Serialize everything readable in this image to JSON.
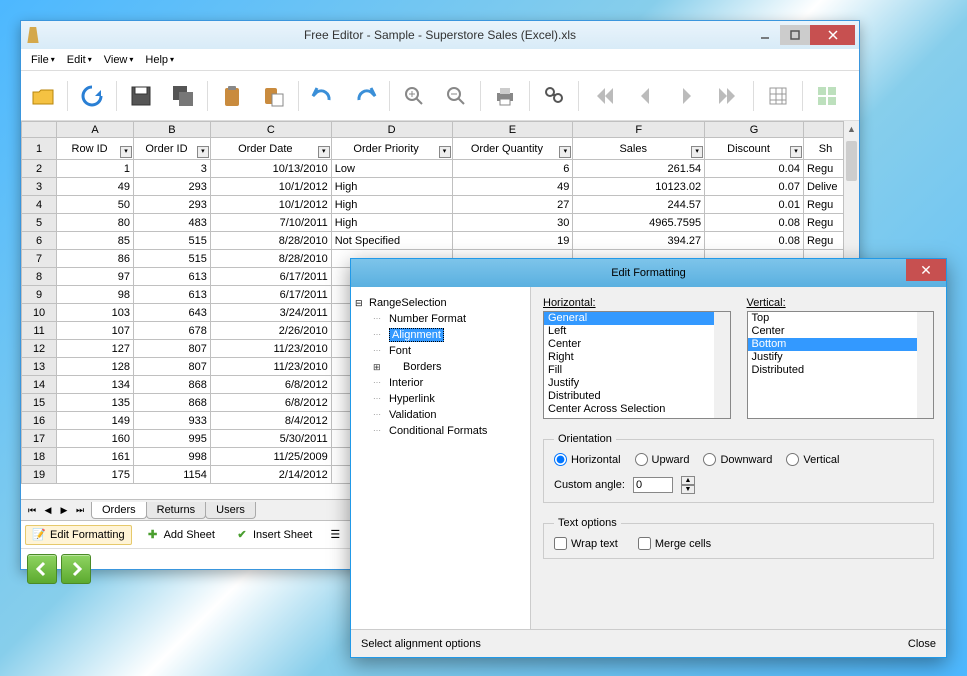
{
  "window": {
    "title": "Free Editor - Sample - Superstore Sales (Excel).xls"
  },
  "menu": {
    "file": "File",
    "edit": "Edit",
    "view": "View",
    "help": "Help"
  },
  "columns_letters": [
    "A",
    "B",
    "C",
    "D",
    "E",
    "F",
    "G",
    ""
  ],
  "field_headers": [
    "Row ID",
    "Order ID",
    "Order Date",
    "Order Priority",
    "Order Quantity",
    "Sales",
    "Discount",
    "Sh"
  ],
  "rows": [
    {
      "n": "2",
      "cells": [
        "1",
        "3",
        "10/13/2010",
        "Low",
        "6",
        "261.54",
        "0.04",
        "Regu"
      ]
    },
    {
      "n": "3",
      "cells": [
        "49",
        "293",
        "10/1/2012",
        "High",
        "49",
        "10123.02",
        "0.07",
        "Delive"
      ]
    },
    {
      "n": "4",
      "cells": [
        "50",
        "293",
        "10/1/2012",
        "High",
        "27",
        "244.57",
        "0.01",
        "Regu"
      ]
    },
    {
      "n": "5",
      "cells": [
        "80",
        "483",
        "7/10/2011",
        "High",
        "30",
        "4965.7595",
        "0.08",
        "Regu"
      ]
    },
    {
      "n": "6",
      "cells": [
        "85",
        "515",
        "8/28/2010",
        "Not Specified",
        "19",
        "394.27",
        "0.08",
        "Regu"
      ]
    },
    {
      "n": "7",
      "cells": [
        "86",
        "515",
        "8/28/2010",
        "",
        "",
        "",
        "",
        ""
      ]
    },
    {
      "n": "8",
      "cells": [
        "97",
        "613",
        "6/17/2011",
        "",
        "",
        "",
        "",
        ""
      ]
    },
    {
      "n": "9",
      "cells": [
        "98",
        "613",
        "6/17/2011",
        "",
        "",
        "",
        "",
        ""
      ]
    },
    {
      "n": "10",
      "cells": [
        "103",
        "643",
        "3/24/2011",
        "",
        "",
        "",
        "",
        ""
      ]
    },
    {
      "n": "11",
      "cells": [
        "107",
        "678",
        "2/26/2010",
        "",
        "",
        "",
        "",
        ""
      ]
    },
    {
      "n": "12",
      "cells": [
        "127",
        "807",
        "11/23/2010",
        "",
        "",
        "",
        "",
        ""
      ]
    },
    {
      "n": "13",
      "cells": [
        "128",
        "807",
        "11/23/2010",
        "",
        "",
        "",
        "",
        ""
      ]
    },
    {
      "n": "14",
      "cells": [
        "134",
        "868",
        "6/8/2012",
        "",
        "",
        "",
        "",
        ""
      ]
    },
    {
      "n": "15",
      "cells": [
        "135",
        "868",
        "6/8/2012",
        "",
        "",
        "",
        "",
        ""
      ]
    },
    {
      "n": "16",
      "cells": [
        "149",
        "933",
        "8/4/2012",
        "",
        "",
        "",
        "",
        ""
      ]
    },
    {
      "n": "17",
      "cells": [
        "160",
        "995",
        "5/30/2011",
        "",
        "",
        "",
        "",
        ""
      ]
    },
    {
      "n": "18",
      "cells": [
        "161",
        "998",
        "11/25/2009",
        "",
        "",
        "",
        "",
        ""
      ]
    },
    {
      "n": "19",
      "cells": [
        "175",
        "1154",
        "2/14/2012",
        "",
        "",
        "",
        "",
        ""
      ]
    }
  ],
  "sheet_tabs": {
    "orders": "Orders",
    "returns": "Returns",
    "users": "Users"
  },
  "bottom_bar": {
    "edit_formatting": "Edit Formatting",
    "add_sheet": "Add Sheet",
    "insert_sheet": "Insert Sheet"
  },
  "dialog": {
    "title": "Edit Formatting",
    "tree": {
      "root": "RangeSelection",
      "number_format": "Number Format",
      "alignment": "Alignment",
      "font": "Font",
      "borders": "Borders",
      "interior": "Interior",
      "hyperlink": "Hyperlink",
      "validation": "Validation",
      "conditional": "Conditional Formats"
    },
    "horizontal_label": "Horizontal:",
    "vertical_label": "Vertical:",
    "horizontal_options": [
      "General",
      "Left",
      "Center",
      "Right",
      "Fill",
      "Justify",
      "Distributed",
      "Center Across Selection"
    ],
    "vertical_options": [
      "Top",
      "Center",
      "Bottom",
      "Justify",
      "Distributed"
    ],
    "orientation_label": "Orientation",
    "orient": {
      "horizontal": "Horizontal",
      "upward": "Upward",
      "downward": "Downward",
      "vertical": "Vertical"
    },
    "custom_angle_label": "Custom angle:",
    "custom_angle_value": "0",
    "text_options_label": "Text options",
    "wrap_text": "Wrap text",
    "merge_cells": "Merge cells",
    "status": "Select alignment options",
    "close": "Close"
  }
}
